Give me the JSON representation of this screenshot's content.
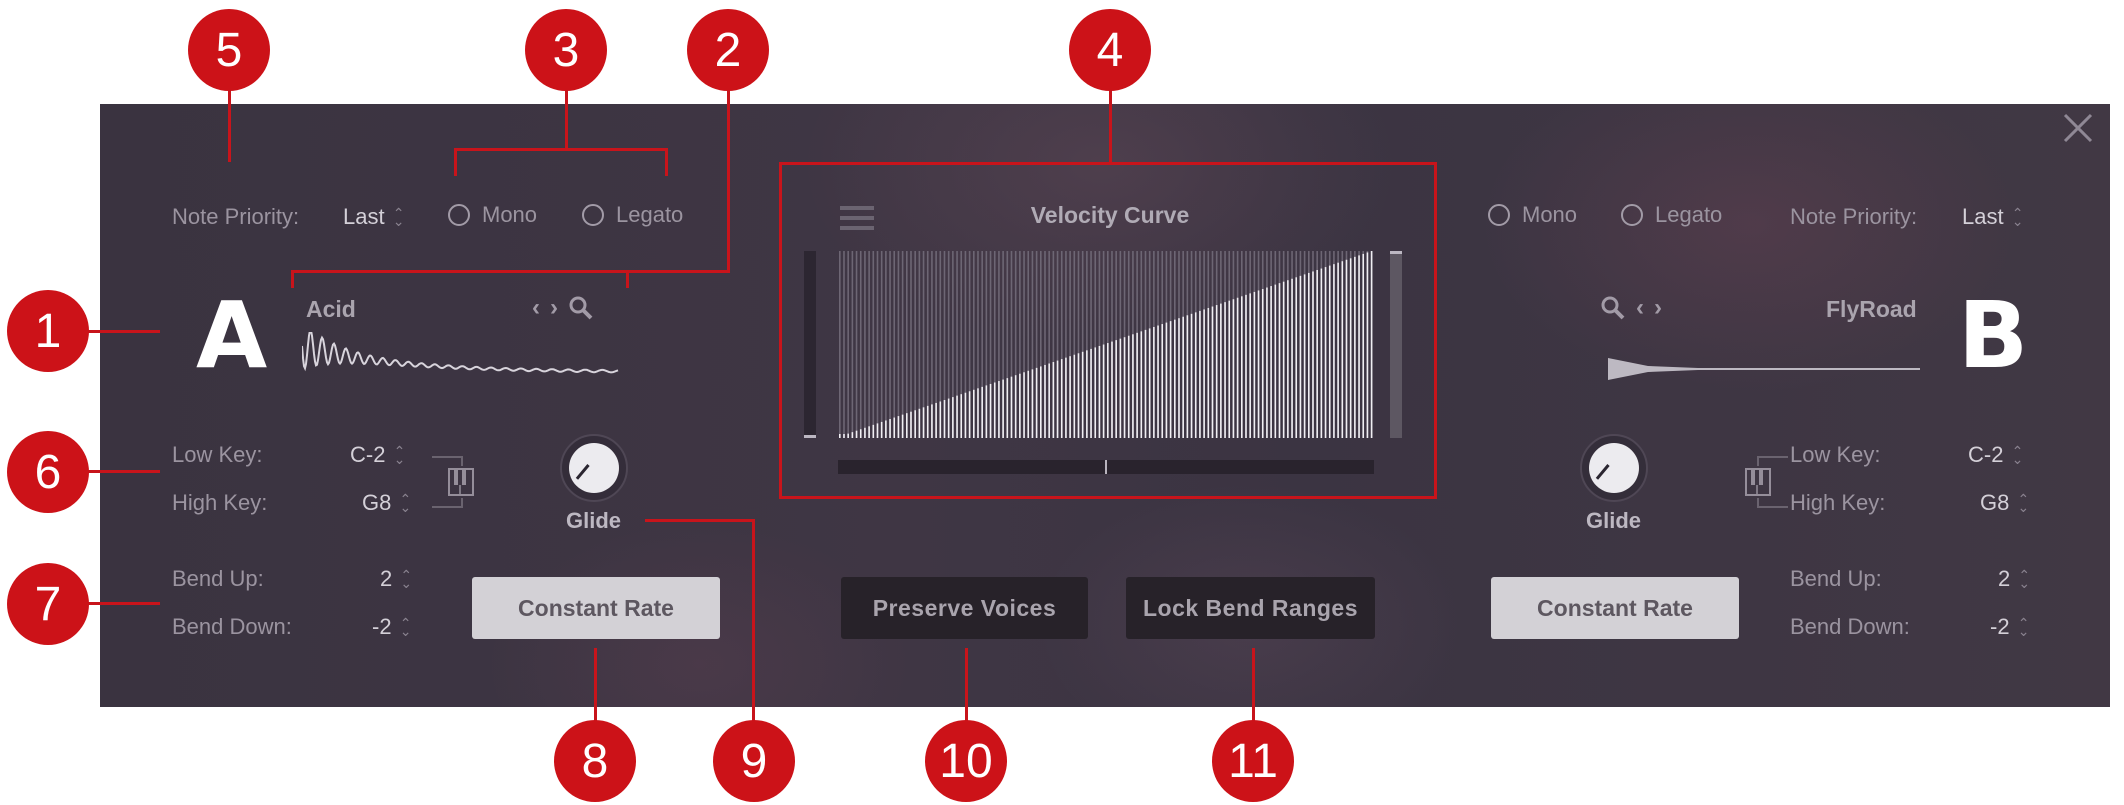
{
  "window": {
    "close_icon": "close-icon"
  },
  "left": {
    "note_priority_label": "Note Priority:",
    "note_priority_value": "Last",
    "mono_label": "Mono",
    "legato_label": "Legato",
    "mono_checked": false,
    "legato_checked": false,
    "slot_letter": "A",
    "preset_name": "Acid",
    "low_key_label": "Low Key:",
    "low_key_value": "C-2",
    "high_key_label": "High Key:",
    "high_key_value": "G8",
    "glide_label": "Glide",
    "bend_up_label": "Bend Up:",
    "bend_up_value": "2",
    "bend_down_label": "Bend Down:",
    "bend_down_value": "-2",
    "constant_rate_label": "Constant Rate"
  },
  "right": {
    "note_priority_label": "Note Priority:",
    "note_priority_value": "Last",
    "mono_label": "Mono",
    "legato_label": "Legato",
    "mono_checked": false,
    "legato_checked": false,
    "slot_letter": "B",
    "preset_name": "FlyRoad",
    "low_key_label": "Low Key:",
    "low_key_value": "C-2",
    "high_key_label": "High Key:",
    "high_key_value": "G8",
    "glide_label": "Glide",
    "bend_up_label": "Bend Up:",
    "bend_up_value": "2",
    "bend_down_label": "Bend Down:",
    "bend_down_value": "-2",
    "constant_rate_label": "Constant Rate"
  },
  "center": {
    "velocity_title": "Velocity Curve",
    "velocity_bars": 128,
    "velocity_curve": "linear",
    "velocity_min_slider": 0.0,
    "velocity_max_slider": 1.0,
    "curve_shape_slider": 0.5,
    "preserve_voices_label": "Preserve Voices",
    "lock_bend_ranges_label": "Lock Bend Ranges"
  },
  "callouts": [
    "1",
    "2",
    "3",
    "4",
    "5",
    "6",
    "7",
    "8",
    "9",
    "10",
    "11"
  ],
  "colors": {
    "callout": "#cc1218",
    "panel": "#3f3743",
    "text_dim": "#9b94a0"
  }
}
